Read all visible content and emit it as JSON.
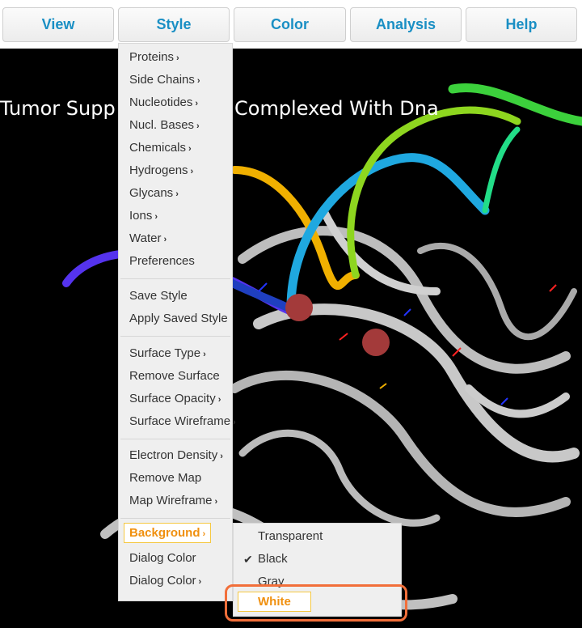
{
  "menubar": {
    "items": [
      "View",
      "Style",
      "Color",
      "Analysis",
      "Help"
    ]
  },
  "viewer": {
    "title_left": "Tumor Supp",
    "title_right": "Complexed With Dna",
    "background_color": "#000000"
  },
  "style_menu": {
    "groups": [
      [
        {
          "label": "Proteins",
          "submenu": true
        },
        {
          "label": "Side Chains",
          "submenu": true
        },
        {
          "label": "Nucleotides",
          "submenu": true
        },
        {
          "label": "Nucl. Bases",
          "submenu": true
        },
        {
          "label": "Chemicals",
          "submenu": true
        },
        {
          "label": "Hydrogens",
          "submenu": true
        },
        {
          "label": "Glycans",
          "submenu": true
        },
        {
          "label": "Ions",
          "submenu": true
        },
        {
          "label": "Water",
          "submenu": true
        },
        {
          "label": "Preferences",
          "submenu": false
        }
      ],
      [
        {
          "label": "Save Style",
          "submenu": false
        },
        {
          "label": "Apply Saved Style",
          "submenu": false
        }
      ],
      [
        {
          "label": "Surface Type",
          "submenu": true
        },
        {
          "label": "Remove Surface",
          "submenu": false
        },
        {
          "label": "Surface Opacity",
          "submenu": true
        },
        {
          "label": "Surface Wireframe",
          "submenu": true
        }
      ],
      [
        {
          "label": "Electron Density",
          "submenu": true
        },
        {
          "label": "Remove Map",
          "submenu": false
        },
        {
          "label": "Map Wireframe",
          "submenu": true
        }
      ],
      [
        {
          "label": "Background",
          "submenu": true,
          "active": true
        },
        {
          "label": "Dialog Color",
          "submenu": false
        },
        {
          "label": "Dialog Color",
          "submenu": true
        }
      ]
    ]
  },
  "background_submenu": {
    "items": [
      {
        "label": "Transparent",
        "checked": false
      },
      {
        "label": "Black",
        "checked": true
      },
      {
        "label": "Gray",
        "checked": false
      },
      {
        "label": "White",
        "checked": false,
        "highlighted": true
      }
    ]
  },
  "icons": {
    "chevron": "›",
    "check": "✔"
  },
  "colors": {
    "accent": "#1a8fc4",
    "highlight": "#f0900f",
    "callout": "#f26f3a"
  }
}
